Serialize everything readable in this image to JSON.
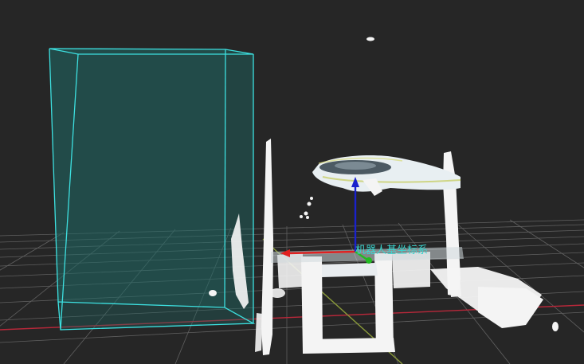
{
  "viewport": {
    "background": "#262626",
    "grid_color": "#6a6a6a",
    "axis_x_color": "#b8283a",
    "axis_y_color": "#8a9a3a"
  },
  "frame": {
    "label": "机器人基坐标系",
    "label_color": "#39d6d0",
    "x_axis_color": "#e02020",
    "y_axis_color": "#22bb22",
    "z_axis_color": "#1a22cc"
  },
  "workspace_box": {
    "edge_color": "#3de0e0",
    "fill_color": "#1f6a66"
  },
  "point_cloud": {
    "color": "#f4f4f4",
    "shadow_color": "#8fa0a8"
  }
}
